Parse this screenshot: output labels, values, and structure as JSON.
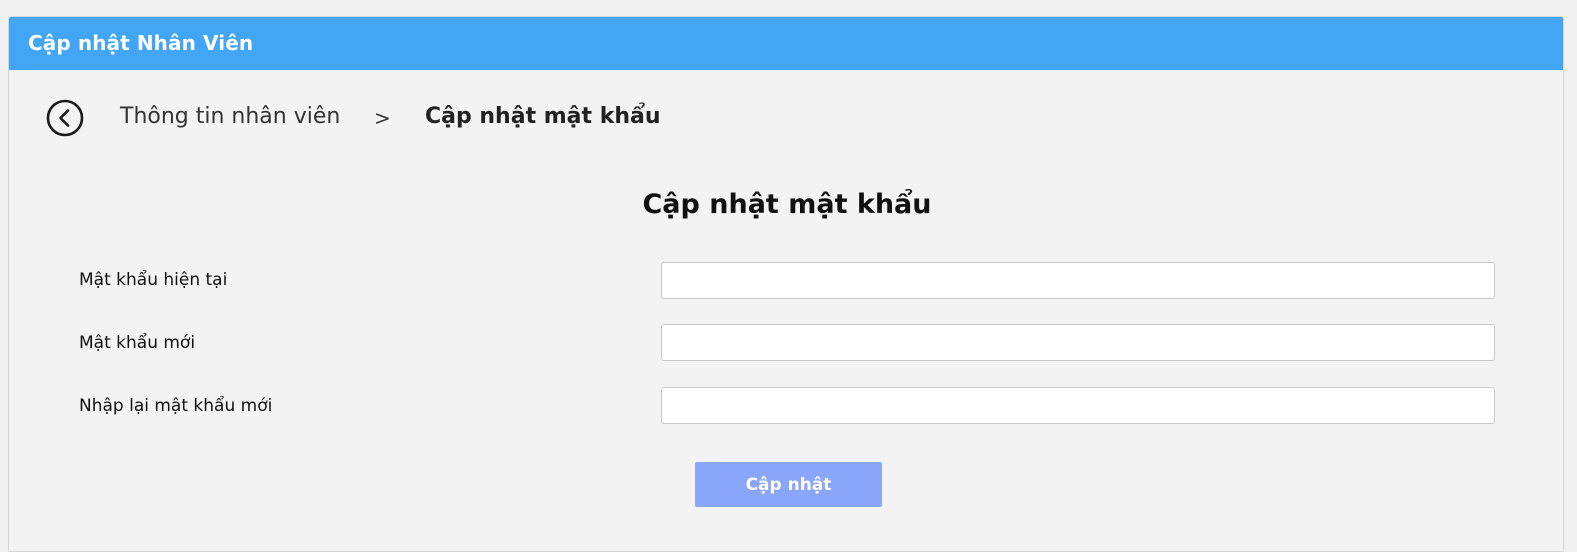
{
  "window": {
    "title": "Cập nhật Nhân Viên"
  },
  "breadcrumb": {
    "back_icon": "chevron-left-circle-icon",
    "parent": "Thông tin nhân viên",
    "separator": ">",
    "current": "Cập nhật mật khẩu"
  },
  "form": {
    "title": "Cập nhật mật khẩu",
    "fields": [
      {
        "label": "Mật khẩu hiện tại",
        "value": ""
      },
      {
        "label": "Mật khẩu mới",
        "value": ""
      },
      {
        "label": "Nhập lại mật khẩu mới",
        "value": ""
      }
    ],
    "submit_label": "Cập nhật"
  },
  "colors": {
    "titlebar": "#42a5f5",
    "background": "#f3f3f3",
    "submit_button": "#8aa6fb"
  }
}
